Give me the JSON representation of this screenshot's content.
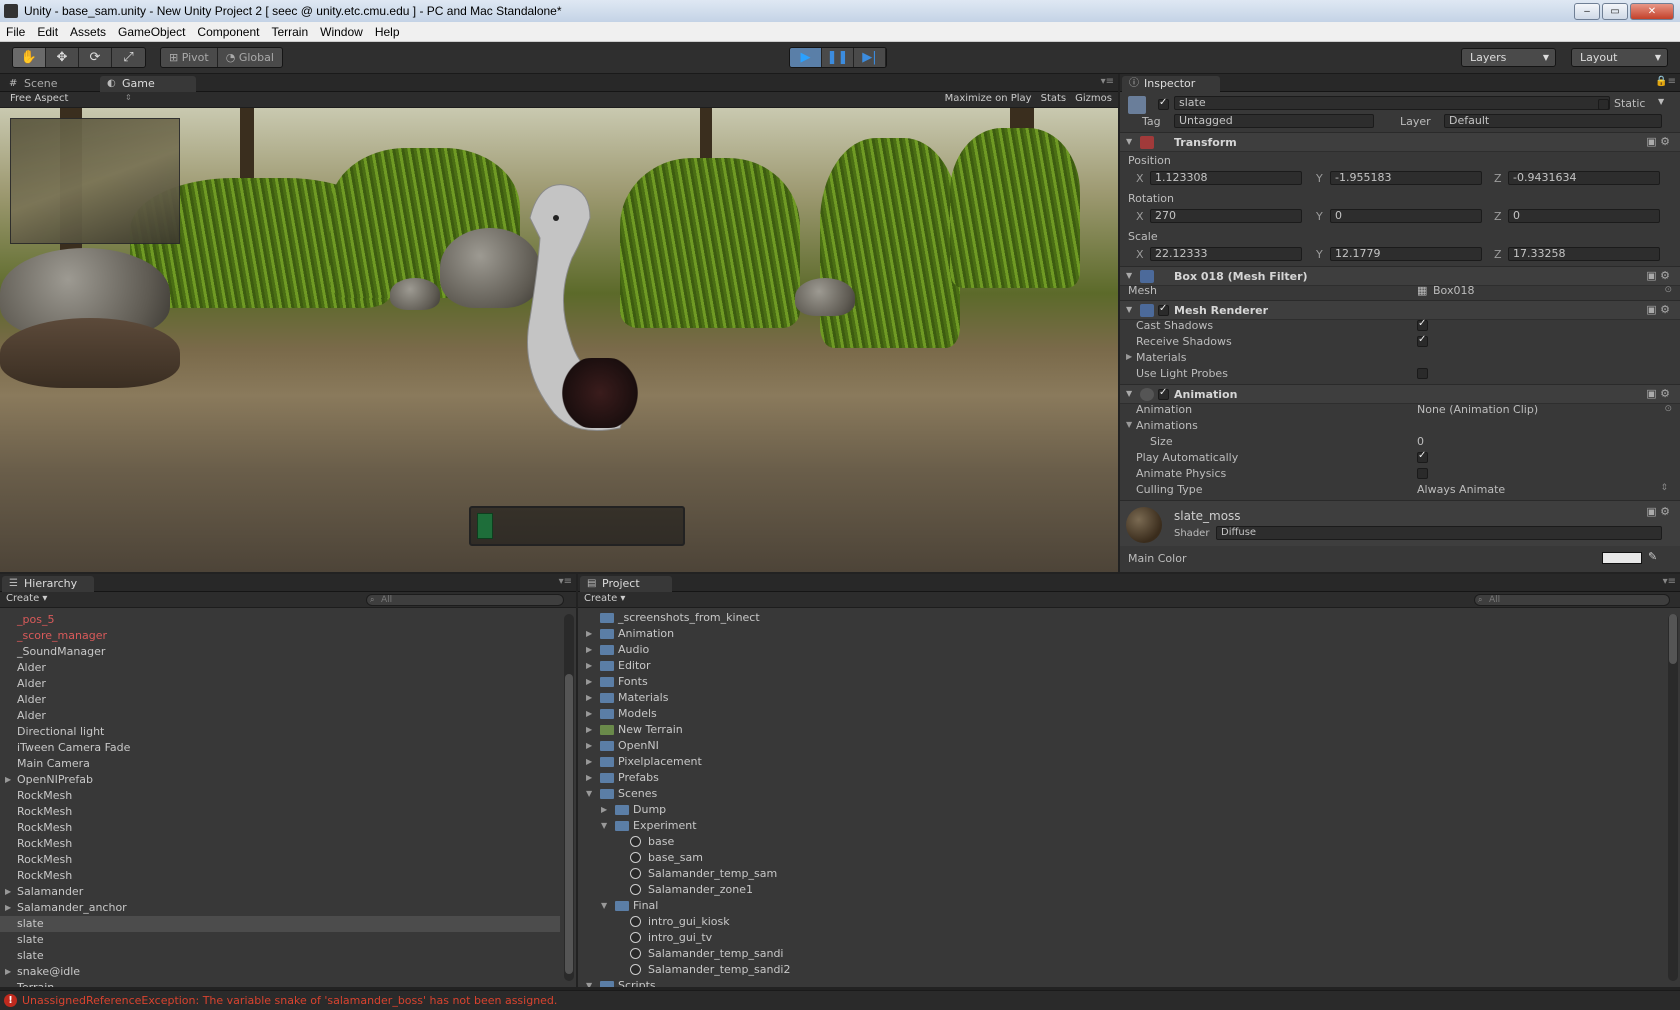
{
  "window": {
    "title": "Unity - base_sam.unity - New Unity Project 2 [ seec @ unity.etc.cmu.edu ] - PC and Mac Standalone*",
    "minimize": "–",
    "maximize": "▭",
    "close": "✕"
  },
  "menu": [
    "File",
    "Edit",
    "Assets",
    "GameObject",
    "Component",
    "Terrain",
    "Window",
    "Help"
  ],
  "toolbar": {
    "tools": [
      "✋",
      "✥",
      "⟳",
      "⤢"
    ],
    "pivot_label": "Pivot",
    "global_label": "Global",
    "play_icons": [
      "▶",
      "❚❚",
      "▶|"
    ],
    "layers_label": "Layers",
    "layout_label": "Layout"
  },
  "game_panel": {
    "tabs": [
      "Scene",
      "Game"
    ],
    "tab_icons": [
      "#",
      "◐"
    ],
    "aspect": "Free Aspect",
    "options": [
      "Maximize on Play",
      "Stats",
      "Gizmos"
    ],
    "ui_bar_fill": 0.08
  },
  "inspector": {
    "tab": "Inspector",
    "tab_icon": "ⓘ",
    "object_name": "slate",
    "static_label": "Static",
    "tag_label": "Tag",
    "tag_value": "Untagged",
    "layer_label": "Layer",
    "layer_value": "Default",
    "transform": {
      "title": "Transform",
      "position_label": "Position",
      "rotation_label": "Rotation",
      "scale_label": "Scale",
      "axes": [
        "X",
        "Y",
        "Z"
      ],
      "position": [
        "1.123308",
        "-1.955183",
        "-0.9431634"
      ],
      "rotation": [
        "270",
        "0",
        "0"
      ],
      "scale": [
        "22.12333",
        "12.1779",
        "17.33258"
      ]
    },
    "mesh_filter": {
      "title": "Box 018 (Mesh Filter)",
      "mesh_label": "Mesh",
      "mesh_value": "Box018"
    },
    "mesh_renderer": {
      "title": "Mesh Renderer",
      "props": [
        {
          "label": "Cast Shadows",
          "checked": true
        },
        {
          "label": "Receive Shadows",
          "checked": true
        },
        {
          "label": "Materials",
          "checked": null
        },
        {
          "label": "Use Light Probes",
          "checked": false
        }
      ]
    },
    "animation": {
      "title": "Animation",
      "animation_label": "Animation",
      "animation_value": "None (Animation Clip)",
      "animations_label": "Animations",
      "size_label": "Size",
      "size_value": "0",
      "play_auto_label": "Play Automatically",
      "animate_physics_label": "Animate Physics",
      "culling_label": "Culling Type",
      "culling_value": "Always Animate"
    },
    "material": {
      "name": "slate_moss",
      "shader_label": "Shader",
      "shader_value": "Diffuse",
      "main_color_label": "Main Color"
    }
  },
  "hierarchy": {
    "tab": "Hierarchy",
    "tab_icon": "☰",
    "create": "Create",
    "search_placeholder": "All",
    "items": [
      {
        "label": "_pos_5",
        "missing": true,
        "fold": false
      },
      {
        "label": "_score_manager",
        "missing": true,
        "fold": false
      },
      {
        "label": "_SoundManager",
        "missing": false,
        "fold": false
      },
      {
        "label": "Alder",
        "missing": false,
        "fold": false
      },
      {
        "label": "Alder",
        "missing": false,
        "fold": false
      },
      {
        "label": "Alder",
        "missing": false,
        "fold": false
      },
      {
        "label": "Alder",
        "missing": false,
        "fold": false
      },
      {
        "label": "Directional light",
        "missing": false,
        "fold": false
      },
      {
        "label": "iTween Camera Fade",
        "missing": false,
        "fold": false
      },
      {
        "label": "Main Camera",
        "missing": false,
        "fold": false
      },
      {
        "label": "OpenNIPrefab",
        "missing": false,
        "fold": true
      },
      {
        "label": "RockMesh",
        "missing": false,
        "fold": false
      },
      {
        "label": "RockMesh",
        "missing": false,
        "fold": false
      },
      {
        "label": "RockMesh",
        "missing": false,
        "fold": false
      },
      {
        "label": "RockMesh",
        "missing": false,
        "fold": false
      },
      {
        "label": "RockMesh",
        "missing": false,
        "fold": false
      },
      {
        "label": "RockMesh",
        "missing": false,
        "fold": false
      },
      {
        "label": "Salamander",
        "missing": false,
        "fold": true
      },
      {
        "label": "Salamander_anchor",
        "missing": false,
        "fold": true
      },
      {
        "label": "slate",
        "missing": false,
        "fold": false,
        "selected": true
      },
      {
        "label": "slate",
        "missing": false,
        "fold": false
      },
      {
        "label": "slate",
        "missing": false,
        "fold": false
      },
      {
        "label": "snake@idle",
        "missing": false,
        "fold": true
      },
      {
        "label": "Terrain",
        "missing": false,
        "fold": false
      }
    ]
  },
  "project": {
    "tab": "Project",
    "tab_icon": "▤",
    "create": "Create",
    "search_placeholder": "All",
    "items": [
      {
        "label": "_screenshots_from_kinect",
        "depth": 0,
        "kind": "folder",
        "fold": ""
      },
      {
        "label": "Animation",
        "depth": 0,
        "kind": "folder",
        "fold": "▶"
      },
      {
        "label": "Audio",
        "depth": 0,
        "kind": "folder",
        "fold": "▶"
      },
      {
        "label": "Editor",
        "depth": 0,
        "kind": "folder",
        "fold": "▶"
      },
      {
        "label": "Fonts",
        "depth": 0,
        "kind": "folder",
        "fold": "▶"
      },
      {
        "label": "Materials",
        "depth": 0,
        "kind": "folder",
        "fold": "▶"
      },
      {
        "label": "Models",
        "depth": 0,
        "kind": "folder",
        "fold": "▶"
      },
      {
        "label": "New Terrain",
        "depth": 0,
        "kind": "terrain",
        "fold": "▶"
      },
      {
        "label": "OpenNI",
        "depth": 0,
        "kind": "folder",
        "fold": "▶"
      },
      {
        "label": "Pixelplacement",
        "depth": 0,
        "kind": "folder",
        "fold": "▶"
      },
      {
        "label": "Prefabs",
        "depth": 0,
        "kind": "folder",
        "fold": "▶"
      },
      {
        "label": "Scenes",
        "depth": 0,
        "kind": "folder",
        "fold": "▼"
      },
      {
        "label": "Dump",
        "depth": 1,
        "kind": "folder",
        "fold": "▶"
      },
      {
        "label": "Experiment",
        "depth": 1,
        "kind": "folder",
        "fold": "▼"
      },
      {
        "label": "base",
        "depth": 2,
        "kind": "scene",
        "fold": ""
      },
      {
        "label": "base_sam",
        "depth": 2,
        "kind": "scene",
        "fold": ""
      },
      {
        "label": "Salamander_temp_sam",
        "depth": 2,
        "kind": "scene",
        "fold": ""
      },
      {
        "label": "Salamander_zone1",
        "depth": 2,
        "kind": "scene",
        "fold": ""
      },
      {
        "label": "Final",
        "depth": 1,
        "kind": "folder",
        "fold": "▼"
      },
      {
        "label": "intro_gui_kiosk",
        "depth": 2,
        "kind": "scene",
        "fold": ""
      },
      {
        "label": "intro_gui_tv",
        "depth": 2,
        "kind": "scene",
        "fold": ""
      },
      {
        "label": "Salamander_temp_sandi",
        "depth": 2,
        "kind": "scene",
        "fold": ""
      },
      {
        "label": "Salamander_temp_sandi2",
        "depth": 2,
        "kind": "scene",
        "fold": ""
      },
      {
        "label": "Scripts",
        "depth": 0,
        "kind": "folder",
        "fold": "▼"
      }
    ]
  },
  "status": {
    "icon": "!",
    "message": "UnassignedReferenceException: The variable snake of 'salamander_boss' has not been assigned."
  },
  "colors": {
    "selected_row": "#4c4c4c",
    "error": "#d9432f",
    "missing_prefab": "#d95a5a",
    "accent_play": "#2aa1ff"
  }
}
